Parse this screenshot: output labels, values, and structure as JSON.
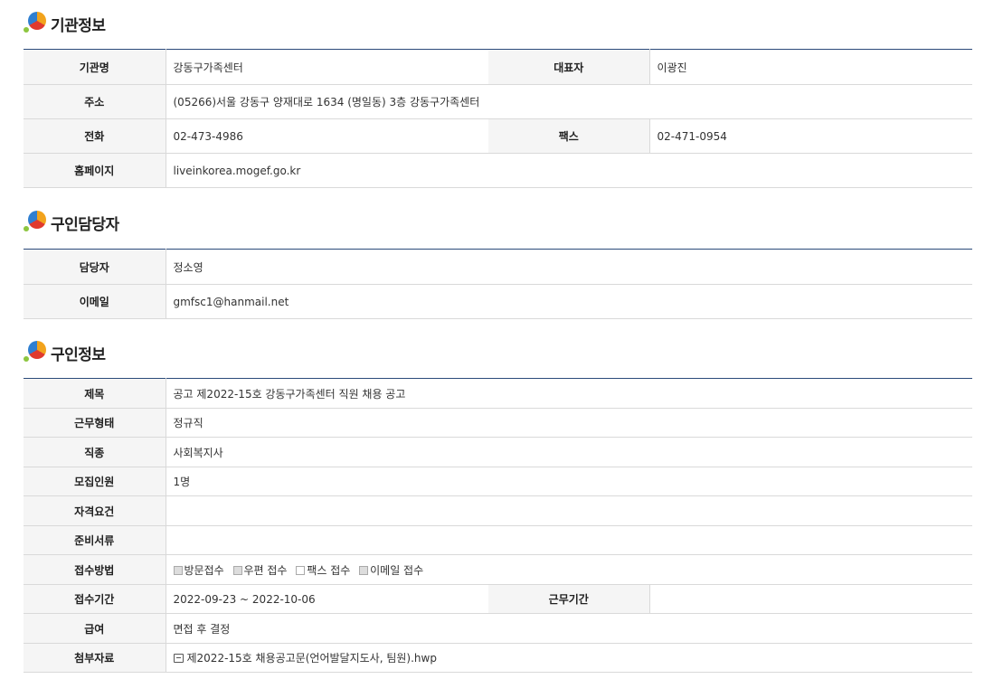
{
  "sections": {
    "org": {
      "title": "기관정보"
    },
    "contact": {
      "title": "구인담당자"
    },
    "job": {
      "title": "구인정보"
    }
  },
  "org": {
    "name_label": "기관명",
    "name": "강동구가족센터",
    "rep_label": "대표자",
    "rep": "이광진",
    "addr_label": "주소",
    "addr": "(05266)서울 강동구 양재대로 1634 (명일동) 3층 강동구가족센터",
    "tel_label": "전화",
    "tel": "02-473-4986",
    "fax_label": "팩스",
    "fax": "02-471-0954",
    "home_label": "홈페이지",
    "home": "liveinkorea.mogef.go.kr"
  },
  "contact": {
    "person_label": "담당자",
    "person": "정소영",
    "email_label": "이메일",
    "email": "gmfsc1@hanmail.net"
  },
  "job": {
    "title_label": "제목",
    "title": "공고 제2022-15호 강동구가족센터 직원 채용 공고",
    "type_label": "근무형태",
    "type": "정규직",
    "kind_label": "직종",
    "kind": "사회복지사",
    "count_label": "모집인원",
    "count": "1명",
    "qual_label": "자격요건",
    "qual": "",
    "docs_label": "준비서류",
    "docs": "",
    "method_label": "접수방법",
    "methods": [
      {
        "label": "방문접수",
        "checked": true
      },
      {
        "label": "우편 접수",
        "checked": true
      },
      {
        "label": "팩스 접수",
        "checked": false
      },
      {
        "label": "이메일 접수",
        "checked": true
      }
    ],
    "period_label": "접수기간",
    "period": "2022-09-23 ~ 2022-10-06",
    "work_period_label": "근무기간",
    "work_period": "",
    "salary_label": "급여",
    "salary": "면접 후 결정",
    "attach_label": "첨부자료",
    "attach": "제2022-15호 채용공고문(언어발달지도사, 팀원).hwp",
    "attach_icon": "file-icon"
  }
}
